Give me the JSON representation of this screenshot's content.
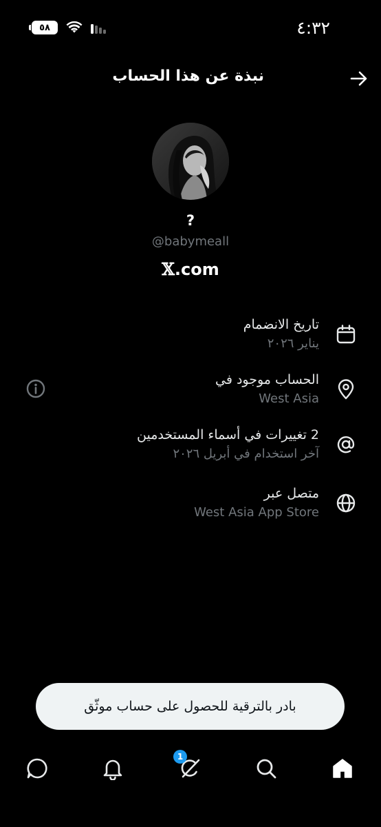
{
  "status_bar": {
    "time": "٤:٣٢",
    "battery": "٥٨"
  },
  "header": {
    "title": "نبذة عن هذا الحساب"
  },
  "profile": {
    "display_name": "?",
    "handle": "@babymeall",
    "brand_mark": "𝕏",
    "brand_suffix": ".com"
  },
  "info": [
    {
      "title": "تاريخ الانضمام",
      "value": "يناير ٢٠٢٦",
      "icon": "calendar-icon"
    },
    {
      "title": "الحساب موجود في",
      "value": "West Asia",
      "icon": "location-pin-icon"
    },
    {
      "title": "2 تغييرات في أسماء المستخدمين",
      "value": "آخر استخدام في أبريل ٢٠٢٦",
      "icon": "at-sign-icon"
    },
    {
      "title": "متصل عبر",
      "value": "West Asia App Store",
      "icon": "globe-icon"
    }
  ],
  "upgrade": {
    "label": "بادر بالترقية للحصول على حساب موثّق"
  },
  "nav": {
    "grok_badge": "1"
  },
  "colors": {
    "background": "#000000",
    "primary_text": "#e7e9ea",
    "secondary_text": "#71767b",
    "accent": "#1d9bf0",
    "banner": "#eff3f4"
  }
}
